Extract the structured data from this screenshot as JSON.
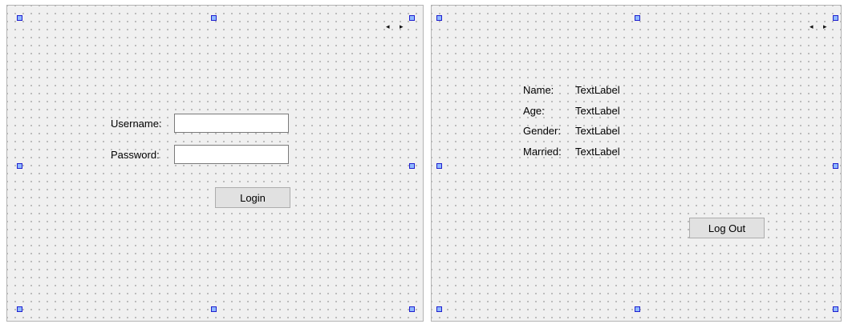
{
  "login_form": {
    "username_label": "Username:",
    "username_value": "",
    "password_label": "Password:",
    "password_value": "",
    "login_button": "Login",
    "nav_arrows": "◂ ▸"
  },
  "profile_form": {
    "name_label": "Name:",
    "name_value": "TextLabel",
    "age_label": "Age:",
    "age_value": "TextLabel",
    "gender_label": "Gender:",
    "gender_value": "TextLabel",
    "married_label": "Married:",
    "married_value": "TextLabel",
    "logout_button": "Log Out",
    "nav_arrows": "◂ ▸"
  }
}
